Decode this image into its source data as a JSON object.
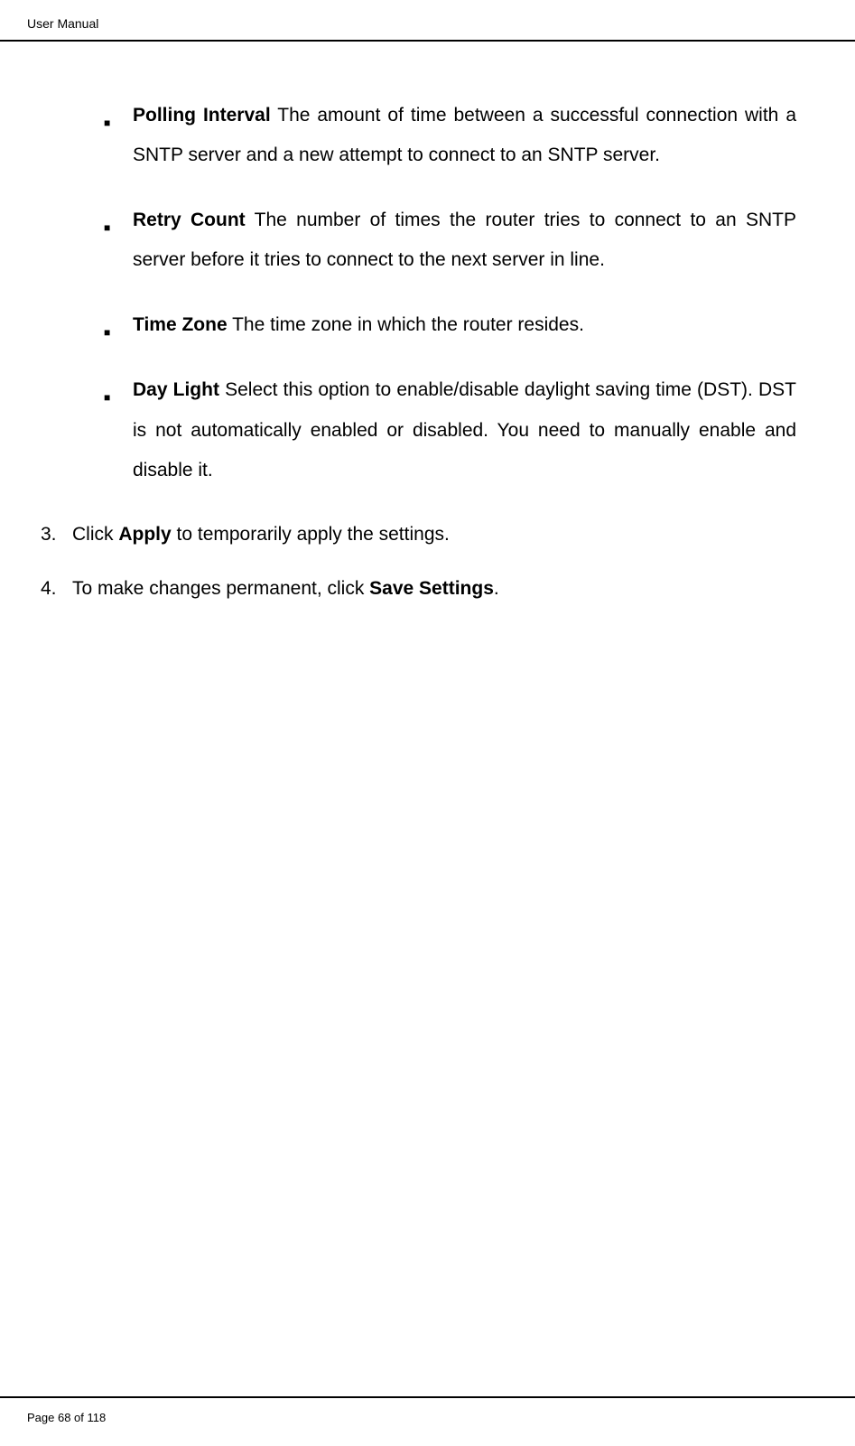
{
  "header": {
    "title": "User Manual"
  },
  "bullets": [
    {
      "label": "Polling Interval",
      "description": " The amount of time between a successful connection with a SNTP server and a new attempt to connect to an SNTP server."
    },
    {
      "label": "Retry Count",
      "description": " The number of times the router tries to connect to an SNTP server before it tries to connect to the next server in line."
    },
    {
      "label": "Time Zone",
      "description": " The time zone in which the router resides."
    },
    {
      "label": "Day Light",
      "description": " Select this option to enable/disable daylight saving time (DST). DST is not automatically enabled or disabled. You need to manually enable and disable it."
    }
  ],
  "steps": [
    {
      "number": "3.",
      "prefix": "Click ",
      "bold": "Apply",
      "suffix": " to temporarily apply the settings."
    },
    {
      "number": "4.",
      "prefix": "To make changes permanent, click ",
      "bold": "Save Settings",
      "suffix": "."
    }
  ],
  "footer": {
    "page_label": "Page 68 of 118"
  }
}
